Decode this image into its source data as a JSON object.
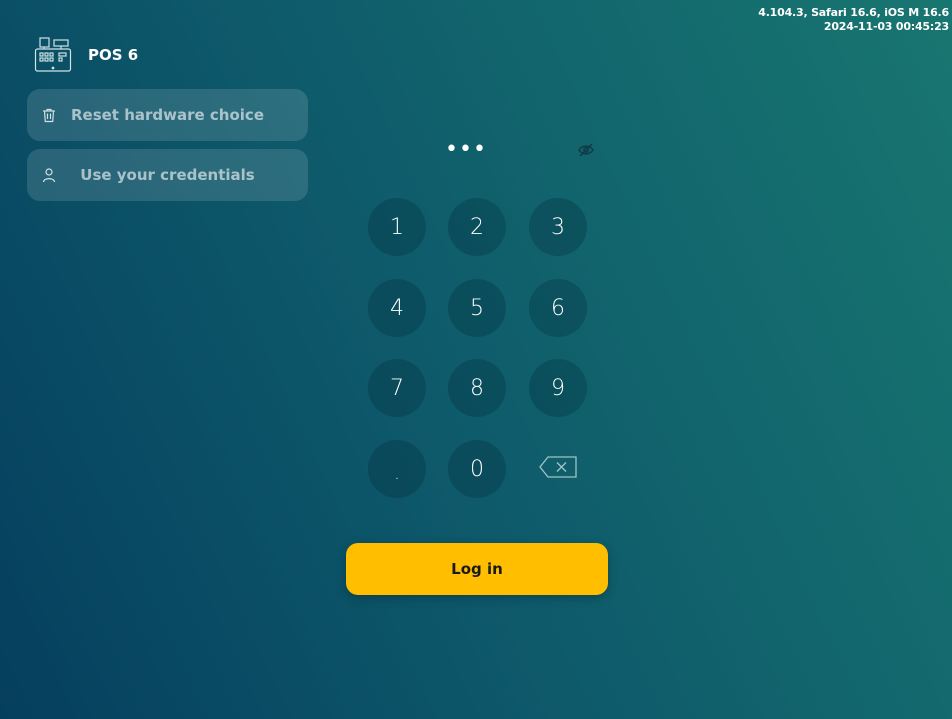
{
  "version": {
    "line1": "4.104.3, Safari 16.6, iOS M 16.6",
    "line2": "2024-11-03 00:45:23"
  },
  "brand": {
    "icon": "cash-register-icon",
    "label": "POS 6"
  },
  "sidebar": {
    "reset_label": "Reset hardware choice",
    "reset_icon": "trash-icon",
    "creds_label": "Use your credentials",
    "creds_icon": "user-icon"
  },
  "pin": {
    "masked_value": "•••",
    "toggle_icon": "eye-slash-icon"
  },
  "keypad": {
    "k1": "1",
    "k2": "2",
    "k3": "3",
    "k4": "4",
    "k5": "5",
    "k6": "6",
    "k7": "7",
    "k8": "8",
    "k9": "9",
    "kdot": ".",
    "k0": "0",
    "backspace_icon": "backspace-icon"
  },
  "login": {
    "label": "Log in"
  },
  "colors": {
    "accent": "#ffbf00",
    "background_start": "#053f5e",
    "background_end": "#187670"
  }
}
